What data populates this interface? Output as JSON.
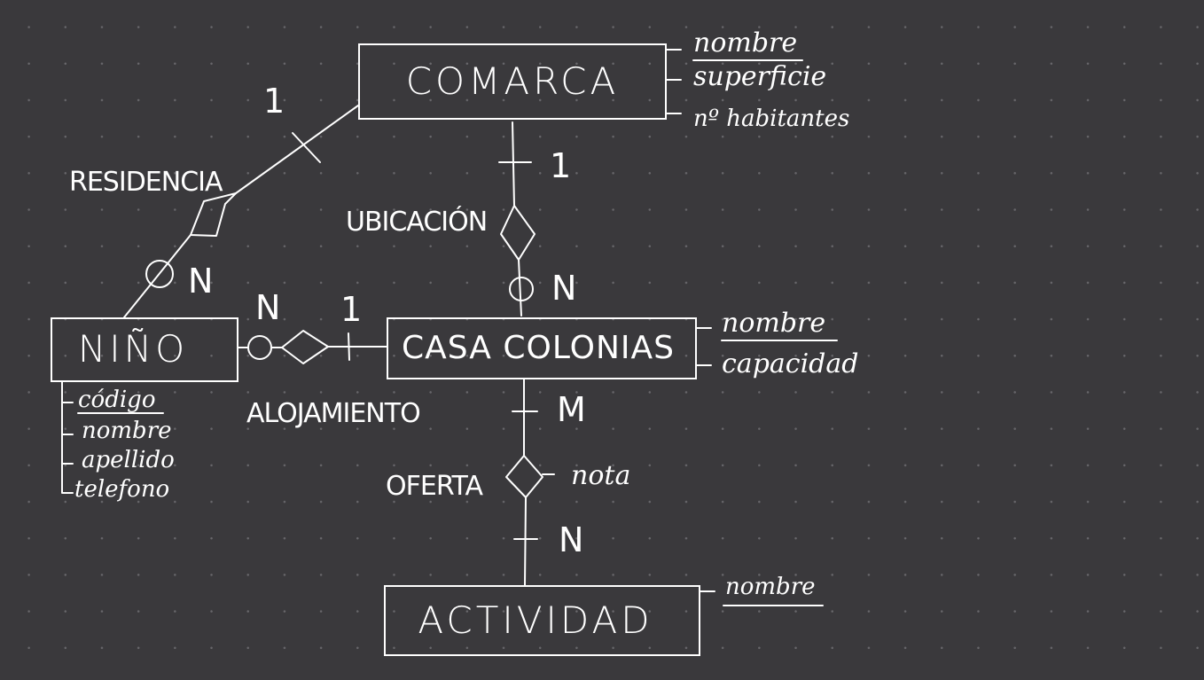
{
  "entities": {
    "comarca": {
      "name": "COMARCA",
      "attributes": [
        "nombre",
        "superficie",
        "nº habitantes"
      ]
    },
    "casa": {
      "name": "CASA COLONIAS",
      "attributes": [
        "nombre",
        "capacidad"
      ]
    },
    "nino": {
      "name": "NIÑO",
      "attributes": [
        "código",
        "nombre",
        "apellido",
        "telefono"
      ]
    },
    "actividad": {
      "name": "ACTIVIDAD",
      "attributes": [
        "nombre"
      ]
    }
  },
  "relationships": {
    "residencia": {
      "name": "RESIDENCIA",
      "card_one": "1",
      "card_many": "N"
    },
    "ubicacion": {
      "name": "UBICACIÓN",
      "card_one": "1",
      "card_many": "N"
    },
    "alojamiento": {
      "name": "ALOJAMIENTO",
      "card_many": "N",
      "card_one": "1"
    },
    "oferta": {
      "name": "OFERTA",
      "card_top": "M",
      "card_bottom": "N",
      "attribute": "nota"
    }
  }
}
